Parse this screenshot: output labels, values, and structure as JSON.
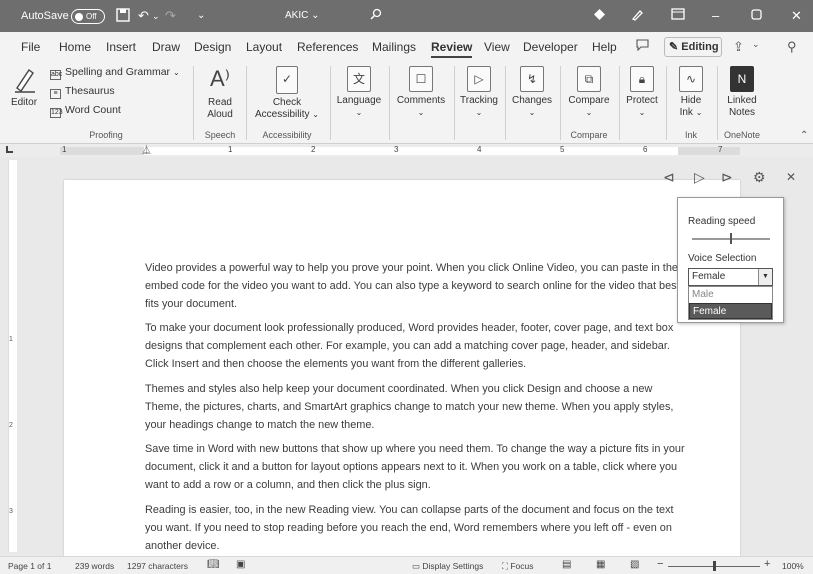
{
  "titlebar": {
    "autosave_label": "AutoSave",
    "autosave_state": "Off",
    "doc_title": "AKIC",
    "doc_title_caret": "⌄",
    "save_icon": "save-icon",
    "undo_icon": "undo-icon",
    "redo_icon": "redo-icon",
    "customize_icon": "customize-icon"
  },
  "menu": {
    "tabs": [
      {
        "label": "File"
      },
      {
        "label": "Home"
      },
      {
        "label": "Insert"
      },
      {
        "label": "Draw"
      },
      {
        "label": "Design"
      },
      {
        "label": "Layout"
      },
      {
        "label": "References"
      },
      {
        "label": "Mailings"
      },
      {
        "label": "Review"
      },
      {
        "label": "View"
      },
      {
        "label": "Developer"
      },
      {
        "label": "Help"
      }
    ],
    "editing_label": "Editing"
  },
  "ribbon": {
    "editor_label": "Editor",
    "proofing": {
      "spelling": "Spelling and Grammar",
      "thesaurus": "Thesaurus",
      "word_count": "Word Count",
      "group": "Proofing"
    },
    "speech": {
      "read_aloud_1": "Read",
      "read_aloud_2": "Aloud",
      "group": "Speech"
    },
    "accessibility": {
      "check_1": "Check",
      "check_2": "Accessibility",
      "group": "Accessibility"
    },
    "language": "Language",
    "comments": "Comments",
    "tracking": "Tracking",
    "changes": "Changes",
    "compare": {
      "label": "Compare",
      "group": "Compare"
    },
    "protect": "Protect",
    "ink": {
      "hide_1": "Hide",
      "hide_2": "Ink",
      "group": "Ink"
    },
    "onenote": {
      "linked_1": "Linked",
      "linked_2": "Notes",
      "group": "OneNote"
    }
  },
  "ruler": {
    "numbers": [
      "1",
      "1",
      "2",
      "3",
      "4",
      "5",
      "6",
      "7"
    ]
  },
  "vruler": {
    "numbers": [
      "1",
      "2",
      "3"
    ]
  },
  "document": {
    "paragraphs": [
      "Video provides a powerful way to help you prove your point. When you click Online Video, you can paste in the embed code for the video you want to add. You can also type a keyword to search online for the video that best fits your document.",
      "To make your document look professionally produced, Word provides header, footer, cover page, and text box designs that complement each other. For example, you can add a matching cover page, header, and sidebar. Click Insert and then choose the elements you want from the different galleries.",
      "Themes and styles also help keep your document coordinated. When you click Design and choose a new Theme, the pictures, charts, and SmartArt graphics change to match your new theme. When you apply styles, your headings change to match the new theme.",
      "Save time in Word with new buttons that show up where you need them. To change the way a picture fits in your document, click it and a button for layout options appears next to it. When you work on a table, click where you want to add a row or a column, and then click the plus sign.",
      "Reading is easier, too, in the new Reading view. You can collapse parts of the document and focus on the text you want. If you need to stop reading before you reach the end, Word remembers where you left off - even on another device."
    ]
  },
  "read_aloud": {
    "reading_speed_label": "Reading speed",
    "reading_speed_value": 0.5,
    "voice_selection_label": "Voice Selection",
    "voice_selected": "Female",
    "voice_options": [
      "Male",
      "Female"
    ]
  },
  "status": {
    "page": "Page 1 of 1",
    "words": "239 words",
    "characters": "1297 characters",
    "display_settings": "Display Settings",
    "focus": "Focus",
    "zoom": "100%",
    "zoom_minus": "−",
    "zoom_plus": "+"
  }
}
